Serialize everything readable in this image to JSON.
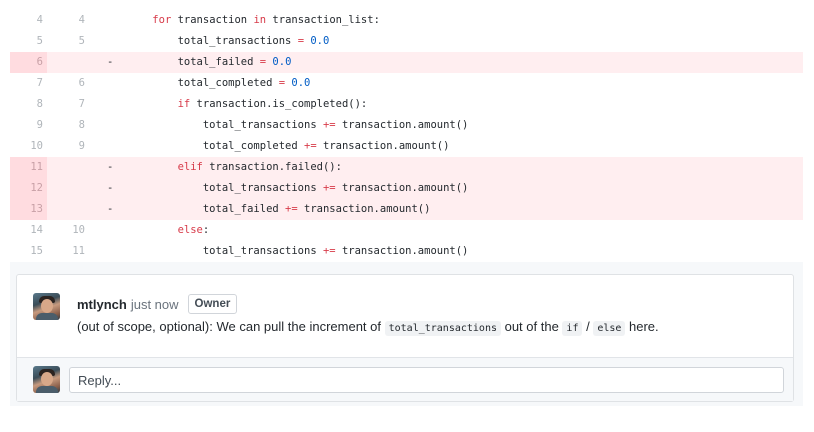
{
  "diff": {
    "lines": [
      {
        "old": "4",
        "new": "4",
        "marker": "",
        "type": "ctx",
        "indent": "    ",
        "tokens": [
          [
            "kw",
            "for"
          ],
          [
            "",
            " transaction "
          ],
          [
            "kw",
            "in"
          ],
          [
            "",
            " transaction_list:"
          ]
        ]
      },
      {
        "old": "5",
        "new": "5",
        "marker": "",
        "type": "ctx",
        "indent": "        ",
        "tokens": [
          [
            "",
            "total_transactions "
          ],
          [
            "op",
            "="
          ],
          [
            "",
            " "
          ],
          [
            "nm",
            "0.0"
          ]
        ]
      },
      {
        "old": "6",
        "new": "",
        "marker": "-",
        "type": "del",
        "indent": "        ",
        "tokens": [
          [
            "",
            "total_failed "
          ],
          [
            "op",
            "="
          ],
          [
            "",
            " "
          ],
          [
            "nm",
            "0.0"
          ]
        ]
      },
      {
        "old": "7",
        "new": "6",
        "marker": "",
        "type": "ctx",
        "indent": "        ",
        "tokens": [
          [
            "",
            "total_completed "
          ],
          [
            "op",
            "="
          ],
          [
            "",
            " "
          ],
          [
            "nm",
            "0.0"
          ]
        ]
      },
      {
        "old": "8",
        "new": "7",
        "marker": "",
        "type": "ctx",
        "indent": "        ",
        "tokens": [
          [
            "kw",
            "if"
          ],
          [
            "",
            " transaction.is_completed():"
          ]
        ]
      },
      {
        "old": "9",
        "new": "8",
        "marker": "",
        "type": "ctx",
        "indent": "            ",
        "tokens": [
          [
            "",
            "total_transactions "
          ],
          [
            "op",
            "+="
          ],
          [
            "",
            " transaction.amount()"
          ]
        ]
      },
      {
        "old": "10",
        "new": "9",
        "marker": "",
        "type": "ctx",
        "indent": "            ",
        "tokens": [
          [
            "",
            "total_completed "
          ],
          [
            "op",
            "+="
          ],
          [
            "",
            " transaction.amount()"
          ]
        ]
      },
      {
        "old": "11",
        "new": "",
        "marker": "-",
        "type": "del",
        "indent": "        ",
        "tokens": [
          [
            "kw",
            "elif"
          ],
          [
            "",
            " transaction.failed():"
          ]
        ]
      },
      {
        "old": "12",
        "new": "",
        "marker": "-",
        "type": "del",
        "indent": "            ",
        "tokens": [
          [
            "",
            "total_transactions "
          ],
          [
            "op",
            "+="
          ],
          [
            "",
            " transaction.amount()"
          ]
        ]
      },
      {
        "old": "13",
        "new": "",
        "marker": "-",
        "type": "del",
        "indent": "            ",
        "tokens": [
          [
            "",
            "total_failed "
          ],
          [
            "op",
            "+="
          ],
          [
            "",
            " transaction.amount()"
          ]
        ]
      },
      {
        "old": "14",
        "new": "10",
        "marker": "",
        "type": "ctx",
        "indent": "        ",
        "tokens": [
          [
            "kw",
            "else"
          ],
          [
            "",
            ":"
          ]
        ]
      },
      {
        "old": "15",
        "new": "11",
        "marker": "",
        "type": "ctx",
        "indent": "            ",
        "tokens": [
          [
            "",
            "total_transactions "
          ],
          [
            "op",
            "+="
          ],
          [
            "",
            " transaction.amount()"
          ]
        ]
      }
    ]
  },
  "comment": {
    "author": "mtlynch",
    "time": "just now",
    "badge": "Owner",
    "text_before": "(out of scope, optional): We can pull the increment of ",
    "code_1": "total_transactions",
    "text_middle": " out of the ",
    "code_2": "if",
    "text_slash": " / ",
    "code_3": "else",
    "text_after": " here."
  },
  "reply": {
    "placeholder": "Reply..."
  },
  "colors": {
    "deleted_line_bg": "#ffeef0",
    "deleted_gutter_bg": "#ffdce0",
    "keyword": "#d73a49",
    "number": "#005cc5"
  }
}
